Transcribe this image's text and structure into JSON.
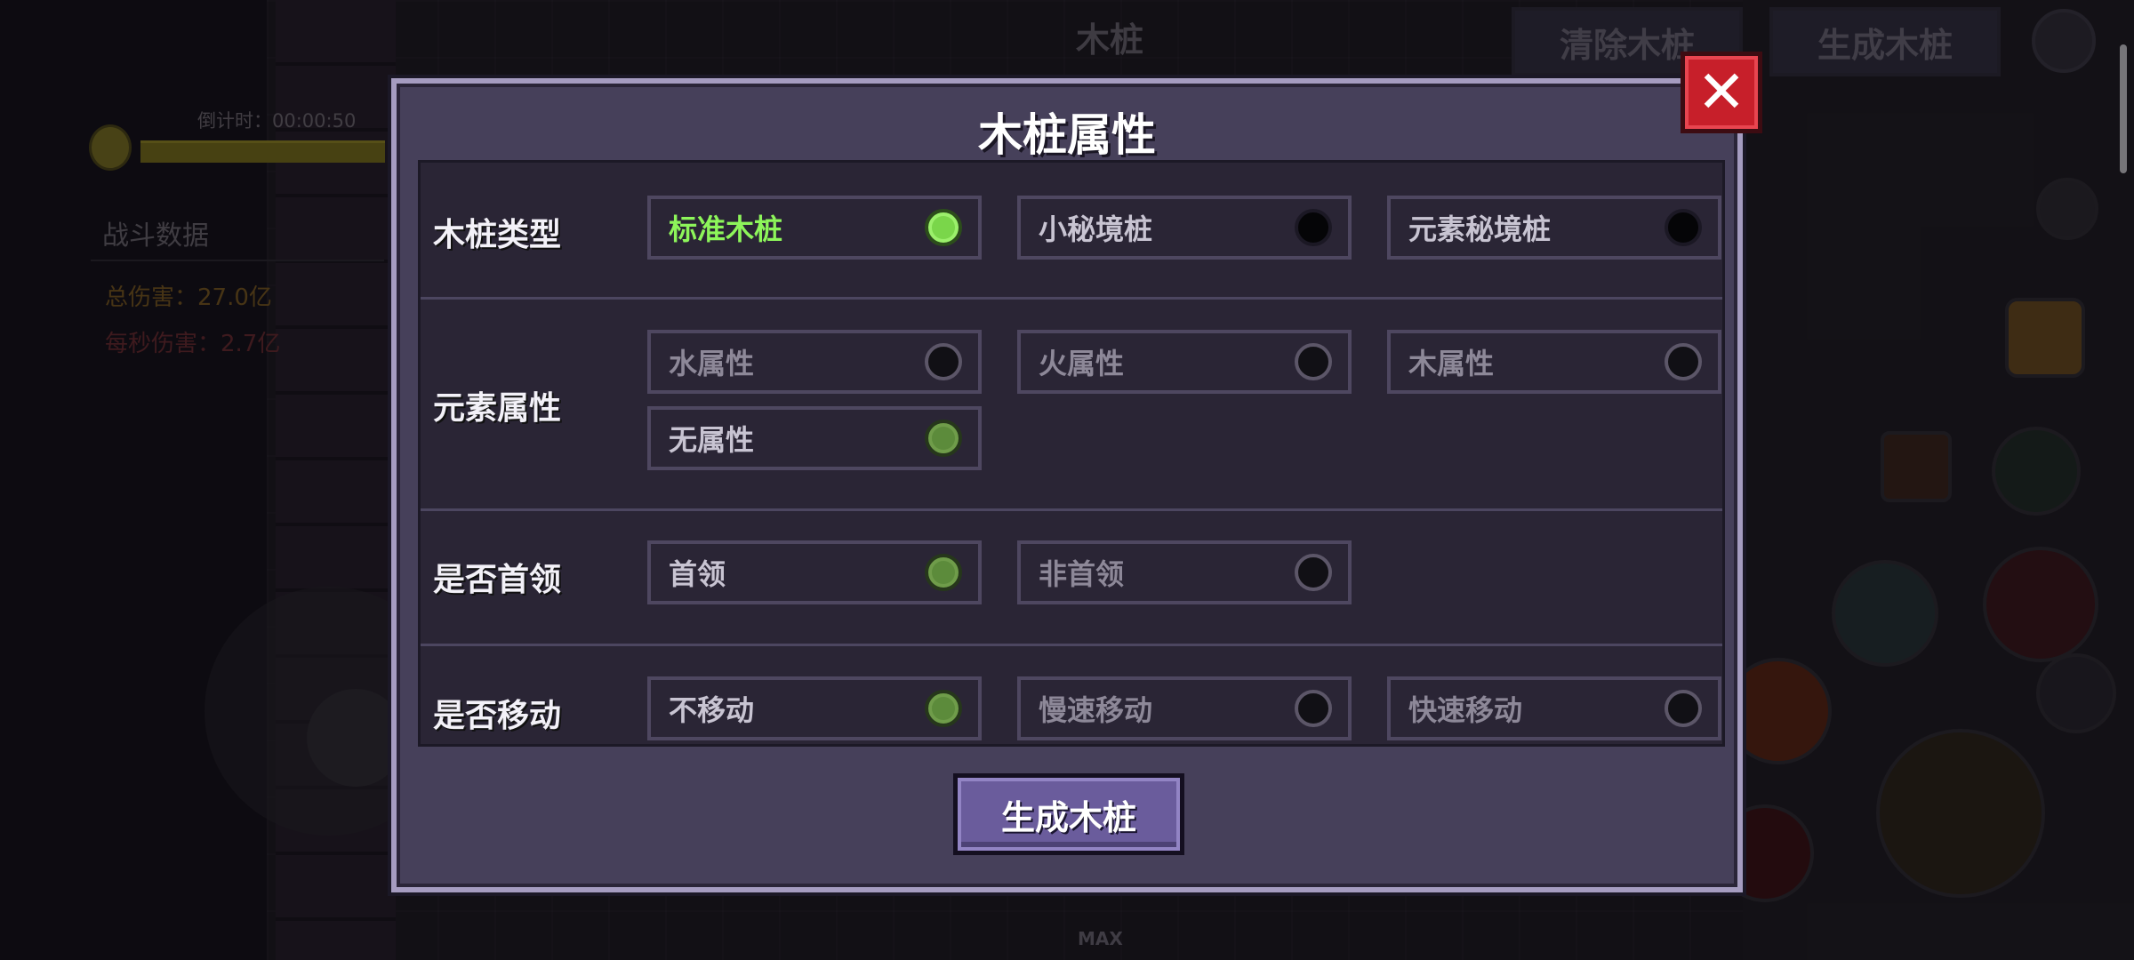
{
  "hud": {
    "top_title": "木桩",
    "clear_button": "清除木桩",
    "spawn_button_top": "生成木桩",
    "timer_label": "倒计时：00:00:50",
    "battle_title": "战斗数据",
    "total_damage": "总伤害：27.0亿",
    "dps": "每秒伤害：2.7亿",
    "max_label": "MAX"
  },
  "modal": {
    "title": "木桩属性",
    "close_glyph": "✕",
    "rows": [
      {
        "label": "木桩类型",
        "options": [
          {
            "label": "标准木桩",
            "selected": true
          },
          {
            "label": "小秘境桩",
            "selected": false
          },
          {
            "label": "元素秘境桩",
            "selected": false
          }
        ]
      },
      {
        "label": "元素属性",
        "options": [
          {
            "label": "水属性",
            "selected": false
          },
          {
            "label": "火属性",
            "selected": false
          },
          {
            "label": "木属性",
            "selected": false
          },
          {
            "label": "无属性",
            "selected": true
          }
        ]
      },
      {
        "label": "是否首领",
        "options": [
          {
            "label": "首领",
            "selected": true
          },
          {
            "label": "非首领",
            "selected": false
          }
        ]
      },
      {
        "label": "是否移动",
        "options": [
          {
            "label": "不移动",
            "selected": true
          },
          {
            "label": "慢速移动",
            "selected": false
          },
          {
            "label": "快速移动",
            "selected": false
          }
        ]
      }
    ],
    "generate_button": "生成木桩"
  },
  "colors": {
    "selected_green": "#8df55a",
    "close_red": "#c71f2a",
    "button_purple": "#6a5c9c"
  }
}
